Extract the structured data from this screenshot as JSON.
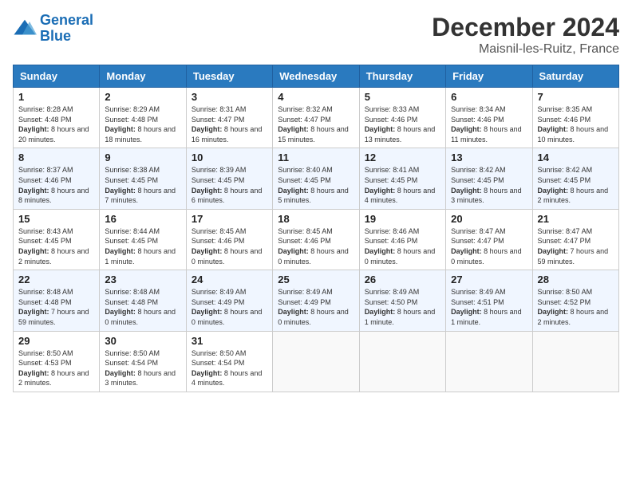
{
  "header": {
    "logo_line1": "General",
    "logo_line2": "Blue",
    "month": "December 2024",
    "location": "Maisnil-les-Ruitz, France"
  },
  "days_of_week": [
    "Sunday",
    "Monday",
    "Tuesday",
    "Wednesday",
    "Thursday",
    "Friday",
    "Saturday"
  ],
  "weeks": [
    [
      {
        "day": 1,
        "text": "Sunrise: 8:28 AM\nSunset: 4:48 PM\nDaylight: 8 hours and 20 minutes."
      },
      {
        "day": 2,
        "text": "Sunrise: 8:29 AM\nSunset: 4:48 PM\nDaylight: 8 hours and 18 minutes."
      },
      {
        "day": 3,
        "text": "Sunrise: 8:31 AM\nSunset: 4:47 PM\nDaylight: 8 hours and 16 minutes."
      },
      {
        "day": 4,
        "text": "Sunrise: 8:32 AM\nSunset: 4:47 PM\nDaylight: 8 hours and 15 minutes."
      },
      {
        "day": 5,
        "text": "Sunrise: 8:33 AM\nSunset: 4:46 PM\nDaylight: 8 hours and 13 minutes."
      },
      {
        "day": 6,
        "text": "Sunrise: 8:34 AM\nSunset: 4:46 PM\nDaylight: 8 hours and 11 minutes."
      },
      {
        "day": 7,
        "text": "Sunrise: 8:35 AM\nSunset: 4:46 PM\nDaylight: 8 hours and 10 minutes."
      }
    ],
    [
      {
        "day": 8,
        "text": "Sunrise: 8:37 AM\nSunset: 4:46 PM\nDaylight: 8 hours and 8 minutes."
      },
      {
        "day": 9,
        "text": "Sunrise: 8:38 AM\nSunset: 4:45 PM\nDaylight: 8 hours and 7 minutes."
      },
      {
        "day": 10,
        "text": "Sunrise: 8:39 AM\nSunset: 4:45 PM\nDaylight: 8 hours and 6 minutes."
      },
      {
        "day": 11,
        "text": "Sunrise: 8:40 AM\nSunset: 4:45 PM\nDaylight: 8 hours and 5 minutes."
      },
      {
        "day": 12,
        "text": "Sunrise: 8:41 AM\nSunset: 4:45 PM\nDaylight: 8 hours and 4 minutes."
      },
      {
        "day": 13,
        "text": "Sunrise: 8:42 AM\nSunset: 4:45 PM\nDaylight: 8 hours and 3 minutes."
      },
      {
        "day": 14,
        "text": "Sunrise: 8:42 AM\nSunset: 4:45 PM\nDaylight: 8 hours and 2 minutes."
      }
    ],
    [
      {
        "day": 15,
        "text": "Sunrise: 8:43 AM\nSunset: 4:45 PM\nDaylight: 8 hours and 2 minutes."
      },
      {
        "day": 16,
        "text": "Sunrise: 8:44 AM\nSunset: 4:45 PM\nDaylight: 8 hours and 1 minute."
      },
      {
        "day": 17,
        "text": "Sunrise: 8:45 AM\nSunset: 4:46 PM\nDaylight: 8 hours and 0 minutes."
      },
      {
        "day": 18,
        "text": "Sunrise: 8:45 AM\nSunset: 4:46 PM\nDaylight: 8 hours and 0 minutes."
      },
      {
        "day": 19,
        "text": "Sunrise: 8:46 AM\nSunset: 4:46 PM\nDaylight: 8 hours and 0 minutes."
      },
      {
        "day": 20,
        "text": "Sunrise: 8:47 AM\nSunset: 4:47 PM\nDaylight: 8 hours and 0 minutes."
      },
      {
        "day": 21,
        "text": "Sunrise: 8:47 AM\nSunset: 4:47 PM\nDaylight: 7 hours and 59 minutes."
      }
    ],
    [
      {
        "day": 22,
        "text": "Sunrise: 8:48 AM\nSunset: 4:48 PM\nDaylight: 7 hours and 59 minutes."
      },
      {
        "day": 23,
        "text": "Sunrise: 8:48 AM\nSunset: 4:48 PM\nDaylight: 8 hours and 0 minutes."
      },
      {
        "day": 24,
        "text": "Sunrise: 8:49 AM\nSunset: 4:49 PM\nDaylight: 8 hours and 0 minutes."
      },
      {
        "day": 25,
        "text": "Sunrise: 8:49 AM\nSunset: 4:49 PM\nDaylight: 8 hours and 0 minutes."
      },
      {
        "day": 26,
        "text": "Sunrise: 8:49 AM\nSunset: 4:50 PM\nDaylight: 8 hours and 1 minute."
      },
      {
        "day": 27,
        "text": "Sunrise: 8:49 AM\nSunset: 4:51 PM\nDaylight: 8 hours and 1 minute."
      },
      {
        "day": 28,
        "text": "Sunrise: 8:50 AM\nSunset: 4:52 PM\nDaylight: 8 hours and 2 minutes."
      }
    ],
    [
      {
        "day": 29,
        "text": "Sunrise: 8:50 AM\nSunset: 4:53 PM\nDaylight: 8 hours and 2 minutes."
      },
      {
        "day": 30,
        "text": "Sunrise: 8:50 AM\nSunset: 4:54 PM\nDaylight: 8 hours and 3 minutes."
      },
      {
        "day": 31,
        "text": "Sunrise: 8:50 AM\nSunset: 4:54 PM\nDaylight: 8 hours and 4 minutes."
      },
      null,
      null,
      null,
      null
    ]
  ]
}
